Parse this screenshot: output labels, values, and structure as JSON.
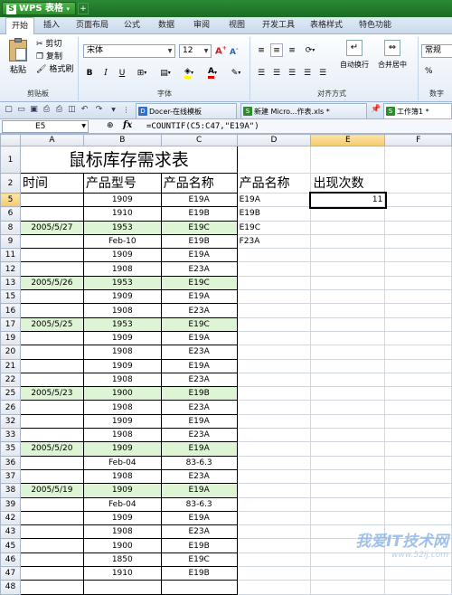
{
  "app": {
    "name": "WPS 表格",
    "logo_letter": "S",
    "plus": "+"
  },
  "ribbon_tabs": [
    "开始",
    "插入",
    "页面布局",
    "公式",
    "数据",
    "审阅",
    "视图",
    "开发工具",
    "表格样式",
    "特色功能"
  ],
  "clipboard": {
    "cut": "剪切",
    "copy": "复制",
    "format_painter": "格式刷",
    "paste": "粘贴",
    "group_label": "剪贴板"
  },
  "font": {
    "name": "宋体",
    "size": "12",
    "bold": "B",
    "italic": "I",
    "underline": "U",
    "grow": "A",
    "shrink": "A",
    "group_label": "字体"
  },
  "alignment": {
    "wrap": "自动换行",
    "merge": "合并居中",
    "group_label": "对齐方式"
  },
  "number": {
    "format": "常规",
    "group_label": "数字",
    "percent": "%"
  },
  "doc_tabs": [
    {
      "icon": "D",
      "label": "Docer-在线模板",
      "color": "#2e6fc7"
    },
    {
      "icon": "S",
      "label": "新建 Micro...作表.xls *",
      "color": "#2b8e2b"
    },
    {
      "icon": "S",
      "label": "工作簿1 *",
      "color": "#2b8e2b"
    }
  ],
  "formula_bar": {
    "cell_ref": "E5",
    "fx": "fx",
    "formula": "=COUNTIF(C5:C47,\"E19A\")"
  },
  "columns": [
    "A",
    "B",
    "C",
    "D",
    "E",
    "F"
  ],
  "sheet": {
    "title": "鼠标库存需求表",
    "headers": {
      "time": "时间",
      "model": "产品型号",
      "name": "产品名称",
      "d_name": "产品名称",
      "count": "出现次数"
    },
    "rows": [
      {
        "n": "5",
        "a": "",
        "b": "1909",
        "c": "E19A",
        "d": "E19A",
        "e": "11",
        "green": false
      },
      {
        "n": "6",
        "a": "",
        "b": "1910",
        "c": "E19B",
        "d": "E19B",
        "e": "",
        "green": false
      },
      {
        "n": "8",
        "a": "2005/5/27",
        "b": "1953",
        "c": "E19C",
        "d": "E19C",
        "e": "",
        "green": true
      },
      {
        "n": "9",
        "a": "",
        "b": "Feb-10",
        "c": "E19B",
        "d": "F23A",
        "e": "",
        "green": false
      },
      {
        "n": "11",
        "a": "",
        "b": "1909",
        "c": "E19A",
        "d": "",
        "e": "",
        "green": false
      },
      {
        "n": "12",
        "a": "",
        "b": "1908",
        "c": "E23A",
        "d": "",
        "e": "",
        "green": false
      },
      {
        "n": "13",
        "a": "2005/5/26",
        "b": "1953",
        "c": "E19C",
        "d": "",
        "e": "",
        "green": true
      },
      {
        "n": "15",
        "a": "",
        "b": "1909",
        "c": "E19A",
        "d": "",
        "e": "",
        "green": false
      },
      {
        "n": "16",
        "a": "",
        "b": "1908",
        "c": "E23A",
        "d": "",
        "e": "",
        "green": false
      },
      {
        "n": "17",
        "a": "2005/5/25",
        "b": "1953",
        "c": "E19C",
        "d": "",
        "e": "",
        "green": true
      },
      {
        "n": "19",
        "a": "",
        "b": "1909",
        "c": "E19A",
        "d": "",
        "e": "",
        "green": false
      },
      {
        "n": "20",
        "a": "",
        "b": "1908",
        "c": "E23A",
        "d": "",
        "e": "",
        "green": false
      },
      {
        "n": "21",
        "a": "",
        "b": "1909",
        "c": "E19A",
        "d": "",
        "e": "",
        "green": false
      },
      {
        "n": "22",
        "a": "",
        "b": "1908",
        "c": "E23A",
        "d": "",
        "e": "",
        "green": false
      },
      {
        "n": "25",
        "a": "2005/5/23",
        "b": "1900",
        "c": "E19B",
        "d": "",
        "e": "",
        "green": true
      },
      {
        "n": "26",
        "a": "",
        "b": "1908",
        "c": "E23A",
        "d": "",
        "e": "",
        "green": false
      },
      {
        "n": "32",
        "a": "",
        "b": "1909",
        "c": "E19A",
        "d": "",
        "e": "",
        "green": false
      },
      {
        "n": "33",
        "a": "",
        "b": "1908",
        "c": "E23A",
        "d": "",
        "e": "",
        "green": false
      },
      {
        "n": "35",
        "a": "2005/5/20",
        "b": "1909",
        "c": "E19A",
        "d": "",
        "e": "",
        "green": true
      },
      {
        "n": "36",
        "a": "",
        "b": "Feb-04",
        "c": "83-6.3",
        "d": "",
        "e": "",
        "green": false
      },
      {
        "n": "37",
        "a": "",
        "b": "1908",
        "c": "E23A",
        "d": "",
        "e": "",
        "green": false
      },
      {
        "n": "38",
        "a": "2005/5/19",
        "b": "1909",
        "c": "E19A",
        "d": "",
        "e": "",
        "green": true
      },
      {
        "n": "39",
        "a": "",
        "b": "Feb-04",
        "c": "83-6.3",
        "d": "",
        "e": "",
        "green": false
      },
      {
        "n": "42",
        "a": "",
        "b": "1909",
        "c": "E19A",
        "d": "",
        "e": "",
        "green": false
      },
      {
        "n": "43",
        "a": "",
        "b": "1908",
        "c": "E23A",
        "d": "",
        "e": "",
        "green": false
      },
      {
        "n": "45",
        "a": "",
        "b": "1900",
        "c": "E19B",
        "d": "",
        "e": "",
        "green": false
      },
      {
        "n": "46",
        "a": "",
        "b": "1850",
        "c": "E19C",
        "d": "",
        "e": "",
        "green": false
      },
      {
        "n": "47",
        "a": "",
        "b": "1910",
        "c": "E19B",
        "d": "",
        "e": "",
        "green": false
      },
      {
        "n": "48",
        "a": "",
        "b": "",
        "c": "",
        "d": "",
        "e": "",
        "green": false
      }
    ]
  },
  "watermark": {
    "main": "我爱IT技术网",
    "url": "www.52ij.com"
  }
}
